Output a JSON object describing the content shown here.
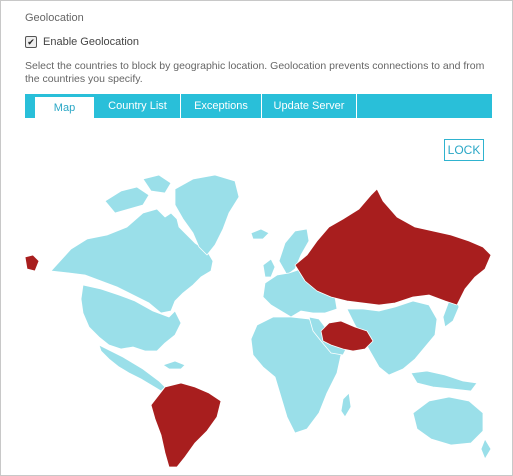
{
  "section": {
    "title": "Geolocation"
  },
  "enable": {
    "label": "Enable Geolocation",
    "checked": true
  },
  "description": "Select the countries to block by geographic location. Geolocation prevents connections to and from the countries you specify.",
  "tabs": [
    {
      "label": "Map",
      "active": true
    },
    {
      "label": "Country List",
      "active": false
    },
    {
      "label": "Exceptions",
      "active": false
    },
    {
      "label": "Update Server",
      "active": false
    }
  ],
  "lock_button": {
    "label": "LOCK"
  },
  "map": {
    "allowed_color": "#9adfe9",
    "blocked_color": "#a81e1e",
    "border_color": "#ffffff",
    "blocked_regions": [
      "Russia",
      "Iran",
      "Afghanistan",
      "South America",
      "Alaska tip"
    ]
  }
}
